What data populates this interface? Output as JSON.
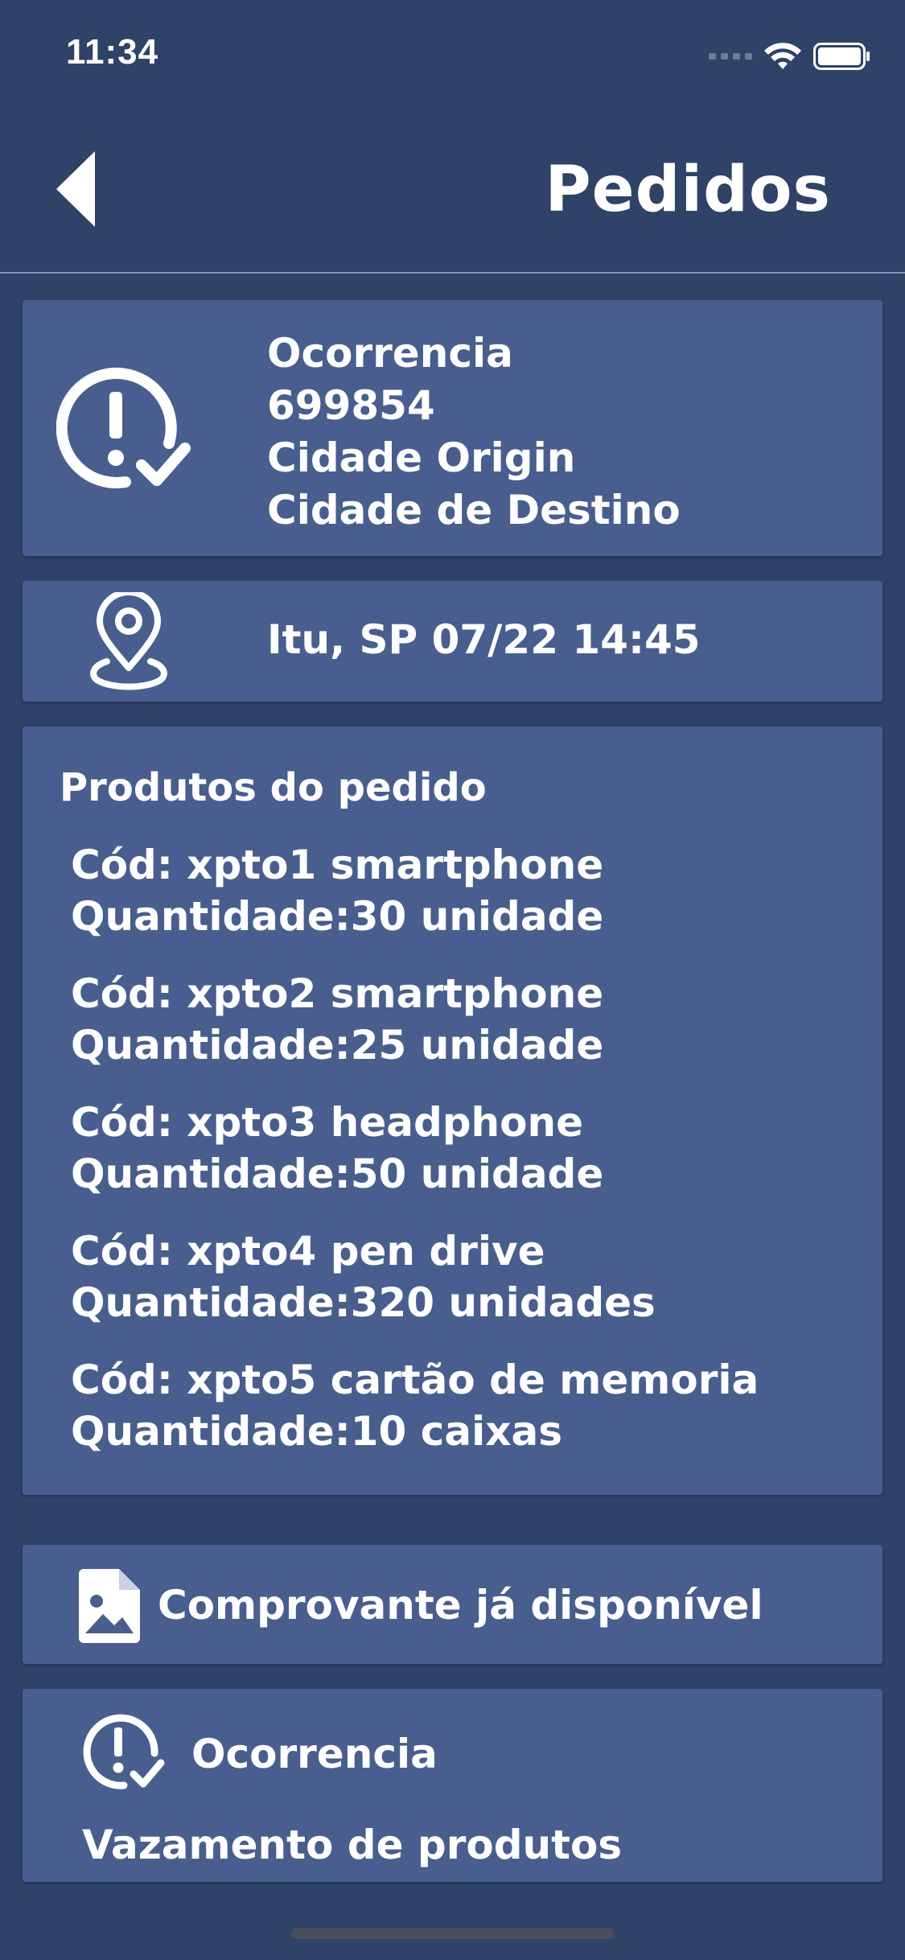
{
  "status_bar": {
    "time": "11:34"
  },
  "nav": {
    "title": "Pedidos"
  },
  "occurrence": {
    "lines": [
      "Ocorrencia",
      "699854",
      "Cidade Origin",
      "Cidade de Destino"
    ]
  },
  "location": {
    "text": "Itu, SP 07/22 14:45"
  },
  "products": {
    "title": "Produtos do pedido",
    "items": [
      {
        "code": "Cód: xpto1 smartphone",
        "quantity": "Quantidade:30 unidade"
      },
      {
        "code": "Cód: xpto2 smartphone",
        "quantity": "Quantidade:25 unidade"
      },
      {
        "code": "Cód: xpto3 headphone",
        "quantity": "Quantidade:50 unidade"
      },
      {
        "code": "Cód: xpto4 pen drive",
        "quantity": "Quantidade:320 unidades"
      },
      {
        "code": "Cód: xpto5 cartão de memoria",
        "quantity": "Quantidade:10 caixas"
      }
    ]
  },
  "receipt": {
    "label": "Comprovante já disponível"
  },
  "incident": {
    "title": "Ocorrencia",
    "description": "Vazamento de produtos"
  },
  "icons": {
    "back": "back-arrow-icon",
    "alert": "alert-check-icon",
    "location": "location-pin-icon",
    "document": "document-image-icon"
  },
  "colors": {
    "background": "#2f4268",
    "card": "#485e8f",
    "text": "#ffffff"
  }
}
